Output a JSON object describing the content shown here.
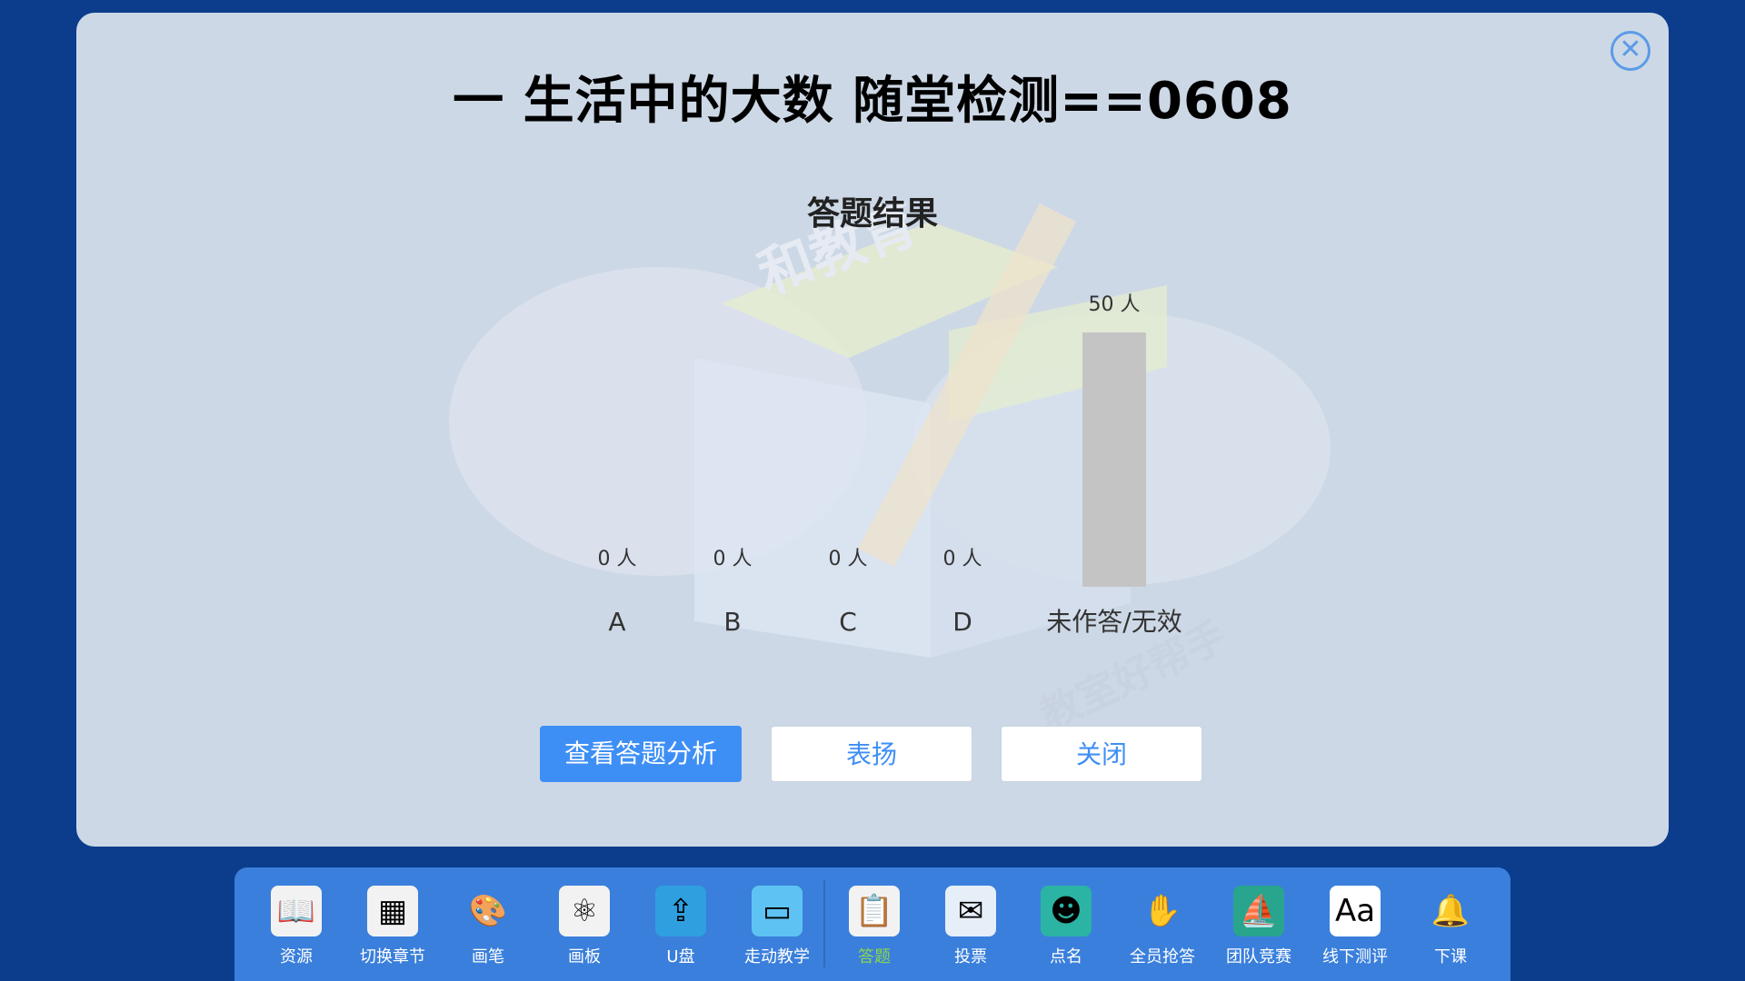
{
  "modal": {
    "title": "一 生活中的大数 随堂检测==0608",
    "close_icon": "close-circle-icon"
  },
  "watermark": {
    "text1": "和教育",
    "text2": "教室好帮手"
  },
  "chart_data": {
    "type": "bar",
    "title": "答题结果",
    "categories": [
      "A",
      "B",
      "C",
      "D",
      "未作答/无效"
    ],
    "values": [
      0,
      0,
      0,
      0,
      50
    ],
    "value_labels": [
      "0 人",
      "0 人",
      "0 人",
      "0 人",
      "50 人"
    ],
    "bar_color": "#c4c4c4",
    "grid": false
  },
  "buttons": {
    "analysis": "查看答题分析",
    "praise": "表扬",
    "close": "关闭"
  },
  "toolbar": {
    "items": [
      {
        "label": "资源",
        "icon": "book-icon"
      },
      {
        "label": "切换章节",
        "icon": "chapter-switch-icon"
      },
      {
        "label": "画笔",
        "icon": "palette-icon"
      },
      {
        "label": "画板",
        "icon": "drawing-board-icon"
      },
      {
        "label": "U盘",
        "icon": "usb-drive-icon"
      },
      {
        "label": "走动教学",
        "icon": "tablet-icon"
      },
      {
        "label": "答题",
        "icon": "answer-clipboard-icon"
      },
      {
        "label": "投票",
        "icon": "vote-envelope-icon"
      },
      {
        "label": "点名",
        "icon": "roll-call-icon"
      },
      {
        "label": "全员抢答",
        "icon": "go-rush-answer-icon"
      },
      {
        "label": "团队竞赛",
        "icon": "team-race-icon"
      },
      {
        "label": "线下测评",
        "icon": "offline-test-icon"
      },
      {
        "label": "下课",
        "icon": "bell-icon"
      }
    ],
    "active_label": "答题",
    "active_color": "#8bd64c"
  }
}
